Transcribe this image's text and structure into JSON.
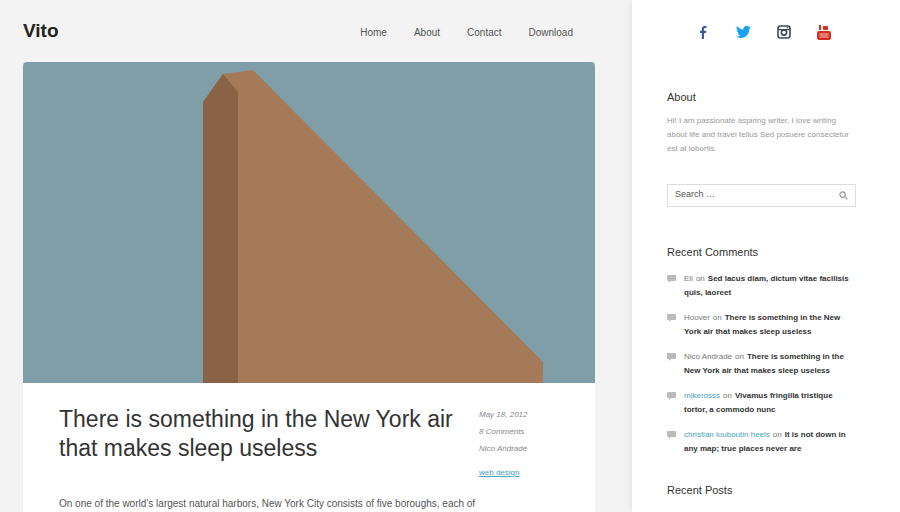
{
  "site": {
    "title": "Vito"
  },
  "nav": [
    {
      "label": "Home"
    },
    {
      "label": "About"
    },
    {
      "label": "Contact"
    },
    {
      "label": "Download"
    }
  ],
  "post": {
    "title": "There is something in the New York air that makes sleep useless",
    "date": "May 18, 2012",
    "comments": "8 Comments",
    "author": "Nico Andrade",
    "category": "web design",
    "excerpt": "On one of the world’s largest natural harbors, New York City consists of five boroughs, each of"
  },
  "sidebar": {
    "about": {
      "heading": "About",
      "text": "Hi! I am passionate aspiring writer, I love writing about life and travel tellus Sed posuere consectetur est at lobortis."
    },
    "search": {
      "placeholder": "Search …"
    },
    "recent_comments": {
      "heading": "Recent Comments",
      "items": [
        {
          "author": "Eli",
          "author_linked": false,
          "on": "on",
          "post": "Sed lacus diam, dictum vitae facilisis quis, laoreet"
        },
        {
          "author": "Hoover",
          "author_linked": false,
          "on": "on",
          "post": "There is something in the New York air that makes sleep useless"
        },
        {
          "author": "Nico Andrade",
          "author_linked": false,
          "on": "on",
          "post": "There is something in the New York air that makes sleep useless"
        },
        {
          "author": "mikerosss",
          "author_linked": true,
          "on": "on",
          "post": "Vivamus fringilla tristique tortor, a commodo nunc"
        },
        {
          "author": "christian louboutin heels",
          "author_linked": true,
          "on": "on",
          "post": "It is not down in any map; true places never are"
        }
      ]
    },
    "recent_posts": {
      "heading": "Recent Posts"
    }
  }
}
